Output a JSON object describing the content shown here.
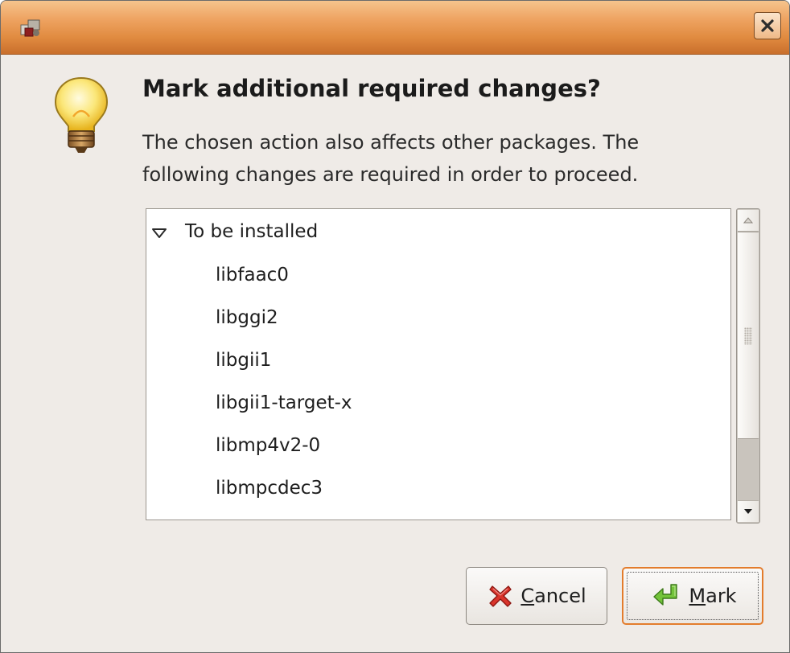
{
  "titlebar": {
    "title": "",
    "app_icon": "package-manager-icon",
    "close_icon": "close-icon"
  },
  "dialog": {
    "icon": "lightbulb-icon",
    "heading": "Mark additional required changes?",
    "description": "The chosen action also affects other packages. The following changes are required in order to proceed."
  },
  "tree": {
    "group": {
      "label": "To be installed",
      "expanded": true,
      "expander_icon": "triangle-down-icon"
    },
    "items": [
      {
        "label": "libfaac0"
      },
      {
        "label": "libggi2"
      },
      {
        "label": "libgii1"
      },
      {
        "label": "libgii1-target-x"
      },
      {
        "label": "libmp4v2-0"
      },
      {
        "label": "libmpcdec3"
      }
    ]
  },
  "scrollbar": {
    "up_icon": "arrow-up-icon",
    "down_icon": "arrow-down-icon",
    "position_fraction": 0.0,
    "visible_fraction": 0.7
  },
  "buttons": {
    "cancel": {
      "mnemonic": "C",
      "rest": "ancel",
      "icon": "cancel-x-icon"
    },
    "mark": {
      "mnemonic": "M",
      "rest": "ark",
      "icon": "green-return-arrow-icon",
      "focused": true
    }
  },
  "colors": {
    "titlebar": "#e08a3f",
    "window_bg": "#efebe7",
    "focus_border": "#e37c2c"
  }
}
